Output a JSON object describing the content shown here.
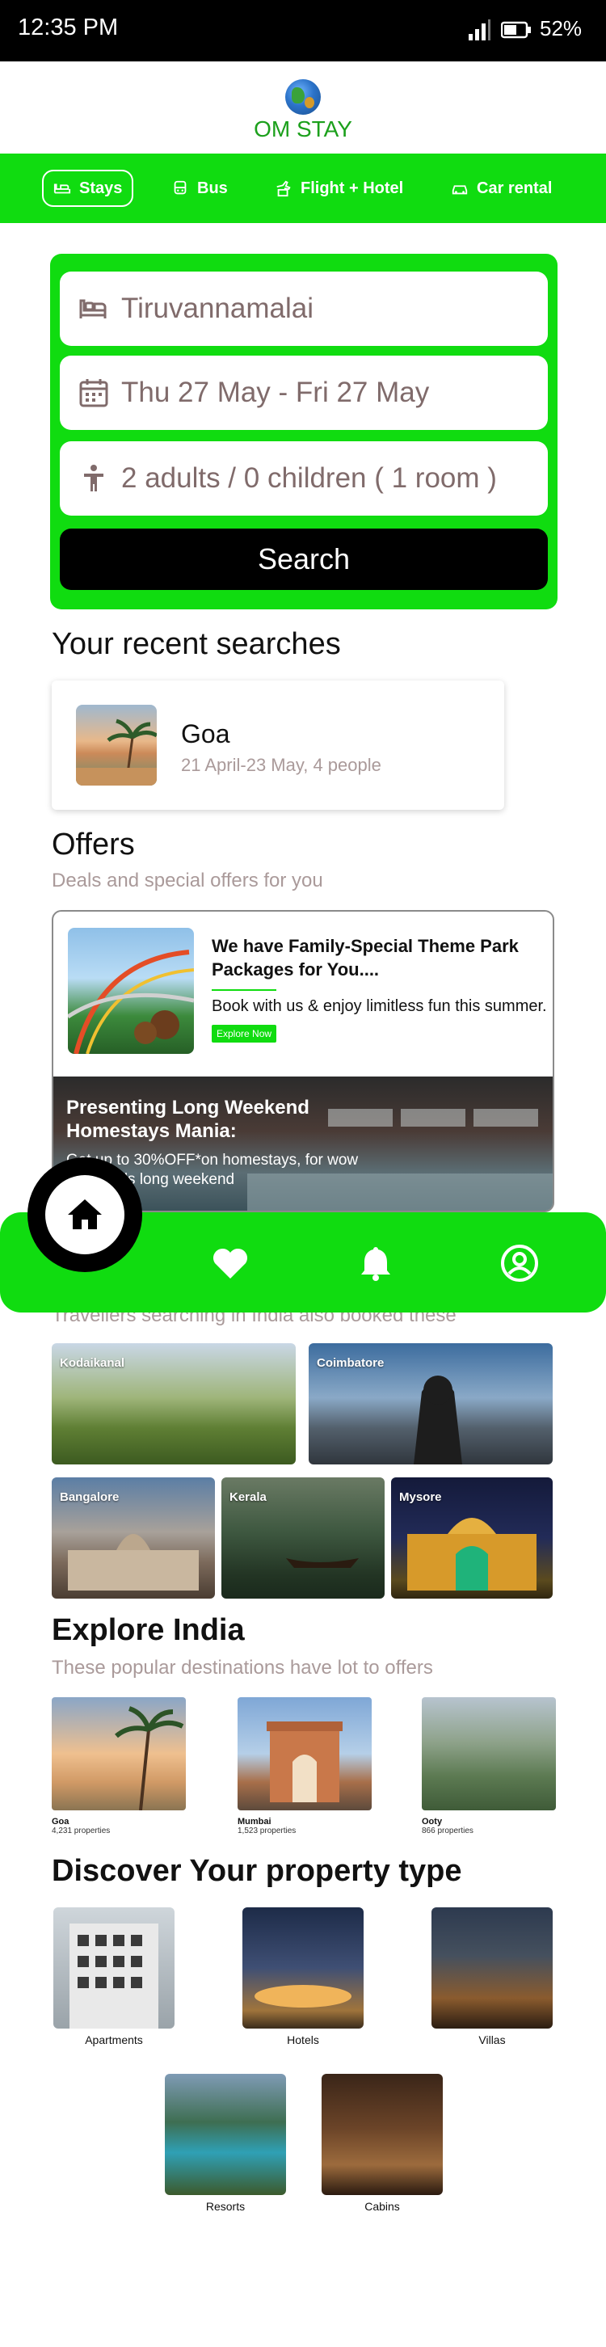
{
  "status_bar": {
    "time": "12:35 PM",
    "battery": "52%"
  },
  "app": {
    "brand": "OM STAY"
  },
  "nav": {
    "tabs": [
      {
        "label": "Stays",
        "icon": "bed-icon",
        "active": true
      },
      {
        "label": "Bus",
        "icon": "bus-icon",
        "active": false
      },
      {
        "label": "Flight + Hotel",
        "icon": "flight-hotel-icon",
        "active": false
      },
      {
        "label": "Car rental",
        "icon": "car-icon",
        "active": false
      }
    ]
  },
  "search": {
    "destination": "Tiruvannamalai",
    "dates": "Thu 27 May - Fri 27 May",
    "guests": "2 adults / 0 children ( 1 room )",
    "button": "Search"
  },
  "recent": {
    "title": "Your recent searches",
    "items": [
      {
        "name": "Goa",
        "meta": "21 April-23 May, 4 people"
      }
    ]
  },
  "offers": {
    "title": "Offers",
    "subtitle": "Deals and special offers for you",
    "items": [
      {
        "title": "We have Family-Special Theme Park Packages for You....",
        "text": "Book with us & enjoy limitless fun this summer.",
        "button": "Explore Now"
      },
      {
        "title": "Presenting Long Weekend Homestays Mania:",
        "text": "Get up to 30%OFF*on homestays, for wow weekends long weekend"
      }
    ]
  },
  "tabbar": {
    "items": [
      "home-icon",
      "heart-icon",
      "bell-icon",
      "profile-icon"
    ]
  },
  "trending": {
    "subtitle": "Travellers searching in India also booked these",
    "places": [
      "Kodaikanal",
      "Coimbatore",
      "Bangalore",
      "Kerala",
      "Mysore"
    ]
  },
  "explore": {
    "title": "Explore India",
    "subtitle": "These popular destinations have lot to offers",
    "cities": [
      {
        "name": "Goa",
        "count": "4,231 properties"
      },
      {
        "name": "Mumbai",
        "count": "1,523 properties"
      },
      {
        "name": "Ooty",
        "count": "866 properties"
      }
    ]
  },
  "property_types": {
    "title": "Discover Your property type",
    "items": [
      "Apartments",
      "Hotels",
      "Villas",
      "Resorts",
      "Cabins"
    ]
  },
  "colors": {
    "accent": "#10dc10",
    "brand_text": "#1ca01c",
    "muted": "#aa9a9a"
  }
}
